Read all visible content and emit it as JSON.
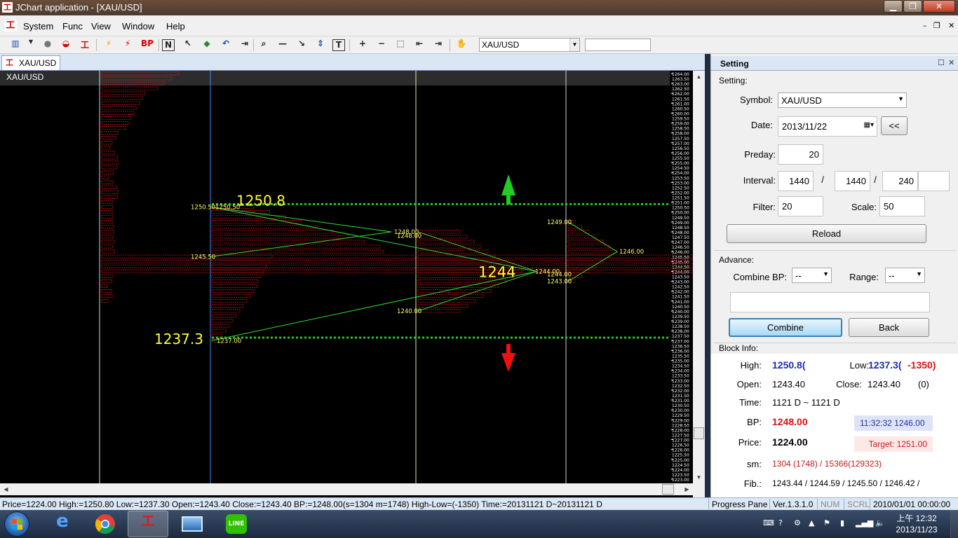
{
  "window": {
    "title": "JChart application - [XAU/USD]",
    "min_glyph": "▁",
    "max_glyph": "❐",
    "close_glyph": "✕"
  },
  "menubar": {
    "logo": "工",
    "items": [
      "System",
      "Func",
      "View",
      "Window",
      "Help"
    ],
    "mdi_min": "–",
    "mdi_restore": "❐",
    "mdi_close": "✕"
  },
  "toolbar": {
    "bp_label": "BP",
    "n_label": "N",
    "t_label": "T",
    "symbol_value": "XAU/USD",
    "search_value": ""
  },
  "document": {
    "tab_label": "XAU/USD",
    "header_symbol": "XAU/USD"
  },
  "chart_data": {
    "type": "market-profile",
    "symbol": "XAU/USD",
    "y_axis_ticks": [
      "1264.00",
      "1263.00",
      "1262.00",
      "1261.00",
      "1260.00",
      "1259.00",
      "1258.00",
      "1257.00",
      "1256.00",
      "1255.00",
      "1254.00",
      "1253.00",
      "1252.00",
      "1251.00",
      "1250.00",
      "1249.00",
      "1248.00",
      "1247.00",
      "1246.00",
      "1245.00",
      "1244.00",
      "1243.00",
      "1242.00",
      "1241.00",
      "1240.00",
      "1239.00",
      "1238.00",
      "1237.00",
      "1236.00",
      "1235.00",
      "1234.00",
      "1233.00",
      "1232.00",
      "1231.00",
      "1230.00",
      "1229.00",
      "1228.00",
      "1227.00",
      "1226.00",
      "1225.00",
      "1224.00",
      "1223.00"
    ],
    "ylim": [
      1223.0,
      1264.0
    ],
    "upper_level": {
      "label": "1250.8",
      "value": 1250.8
    },
    "lower_level": {
      "label": "1237.3",
      "value": 1237.3
    },
    "center_label": {
      "label": "1244",
      "value": 1244.0
    },
    "profiles": [
      {
        "name": "profile-1",
        "high": 1264.0,
        "low": 1241.0,
        "labels": []
      },
      {
        "name": "profile-2",
        "high": 1250.5,
        "low": 1237.0,
        "labels": [
          "1250.50",
          "1250.50",
          "1245.50",
          "1237.00"
        ]
      },
      {
        "name": "profile-3",
        "high": 1248.0,
        "low": 1240.0,
        "labels": [
          "1248.00",
          "1248.00",
          "1244.00",
          "1244.00",
          "1240.00"
        ]
      },
      {
        "name": "profile-4",
        "high": 1249.0,
        "low": 1243.0,
        "labels": [
          "1249.00",
          "1246.00",
          "1243.00"
        ]
      }
    ],
    "value_labels": [
      {
        "text": "1250.50",
        "value": 1250.5
      },
      {
        "text": "1250.50",
        "value": 1250.5
      },
      {
        "text": "1245.50",
        "value": 1245.5
      },
      {
        "text": "1237.00",
        "value": 1237.0
      },
      {
        "text": "1248.00",
        "value": 1248.0
      },
      {
        "text": "1248.00",
        "value": 1247.6
      },
      {
        "text": "1244.00",
        "value": 1244.0
      },
      {
        "text": "1244.00",
        "value": 1243.7
      },
      {
        "text": "1240.00",
        "value": 1240.0
      },
      {
        "text": "1249.00",
        "value": 1249.0
      },
      {
        "text": "1246.00",
        "value": 1246.0
      },
      {
        "text": "1243.00",
        "value": 1243.0
      }
    ],
    "colors": {
      "background": "#000000",
      "profile": "#e01818",
      "bands": "#33dd33",
      "levels": "#22cc22",
      "up_arrow": "#22cc22",
      "down_arrow": "#ee1111",
      "level_text": "#ffff33",
      "price_text": "#ffff66",
      "session_lines": [
        "#4488ff",
        "#e8e8a0",
        "#d0d0d0"
      ]
    }
  },
  "setting_panel": {
    "title": "Setting",
    "pin_glyph": "☐",
    "close_glyph": "✕",
    "group_setting": "Setting:",
    "symbol_label": "Symbol:",
    "symbol_value": "XAU/USD",
    "date_label": "Date:",
    "date_value": "2013/11/22",
    "date_prev_button": "<<",
    "preday_label": "Preday:",
    "preday_value": "20",
    "interval_label": "Interval:",
    "interval_1": "1440",
    "interval_2": "1440",
    "interval_3": "240",
    "interval_4": "",
    "interval_sep": "/",
    "filter_label": "Filter:",
    "filter_value": "20",
    "scale_label": "Scale:",
    "scale_value": "50",
    "reload_button": "Reload",
    "group_advance": "Advance:",
    "combine_bp_label": "Combine BP:",
    "combine_bp_value": "--",
    "range_label": "Range:",
    "range_value": "--",
    "advance_text": "",
    "combine_button": "Combine",
    "back_button": "Back",
    "group_block": "Block Info:",
    "block": {
      "high_label": "High:",
      "high_value": "1250.8(",
      "low_label": "Low:",
      "low_value": "1237.3(",
      "low_extra": "-1350)",
      "open_label": "Open:",
      "open_value": "1243.40",
      "close_label": "Close:",
      "close_value": "1243.40",
      "close_extra": "(0)",
      "time_label": "Time:",
      "time_value": "1121 D ~ 1121 D",
      "bp_label": "BP:",
      "bp_value": "1248.00",
      "bp_box": "11:32:32  1246.00",
      "price_label": "Price:",
      "price_value": "1224.00",
      "target_box": "Target: 1251.00",
      "sm_label": "sm:",
      "sm_value": "1304 (1748) / 15366(129323)",
      "fib_label": "Fib.:",
      "fib_value": "1243.44 / 1244.59 / 1245.50 / 1246.42 /"
    }
  },
  "statusbar": {
    "main": "Price=1224.00  High:=1250.80  Low:=1237.30  Open:=1243.40  Close:=1243.40  BP:=1248.00(s=1304 m=1748)  High-Low=(-1350)  Time:=20131121 D~20131121 D",
    "progress": "Progress Pane",
    "version": "Ver.1.3.1.0",
    "num": "NUM",
    "scrl": "SCRL",
    "datetime": "2010/01/01 00:00:00"
  },
  "taskbar": {
    "clock_period": "上午 12:32",
    "clock_date": "2013/11/23",
    "jchart_glyph": "工",
    "line_label": "LINE"
  }
}
